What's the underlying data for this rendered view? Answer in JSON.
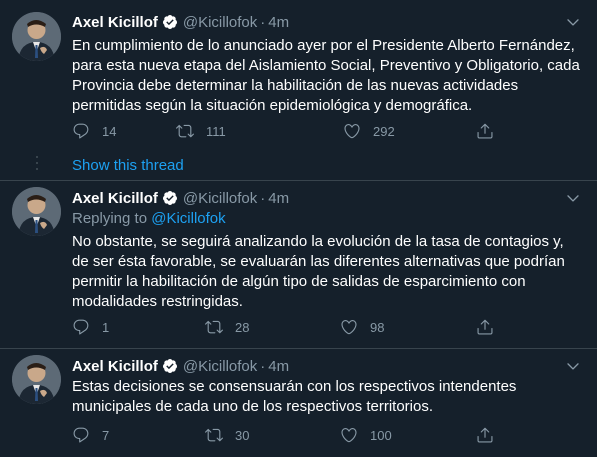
{
  "tweets": [
    {
      "name": "Axel Kicillof",
      "handle": "@Kicillofok",
      "time": "4m",
      "reply_prefix": "",
      "reply_handle": "",
      "text": "En cumplimiento de lo anunciado ayer por el Presidente Alberto Fernández, para esta nueva etapa del Aislamiento Social, Preventivo y Obligatorio, cada Provincia debe determinar la habilitación de las nuevas actividades permitidas según la situación epidemiológica y demográfica.",
      "replies": "14",
      "retweets": "111",
      "likes": "292"
    },
    {
      "name": "Axel Kicillof",
      "handle": "@Kicillofok",
      "time": "4m",
      "reply_prefix": "Replying to ",
      "reply_handle": "@Kicillofok",
      "text": "No obstante, se seguirá analizando la evolución de la tasa de contagios y, de ser ésta favorable, se evaluarán las diferentes alternativas que podrían permitir la habilitación de algún tipo de salidas de esparcimiento con modalidades restringidas.",
      "replies": "1",
      "retweets": "28",
      "likes": "98"
    },
    {
      "name": "Axel Kicillof",
      "handle": "@Kicillofok",
      "time": "4m",
      "reply_prefix": "",
      "reply_handle": "",
      "text": "Estas decisiones se consensuarán con los respectivos intendentes municipales de cada uno de los respectivos territorios.",
      "replies": "7",
      "retweets": "30",
      "likes": "100"
    }
  ],
  "show_thread": "Show this thread",
  "separator": "·",
  "colors": {
    "background": "#15202b",
    "accent": "#1da1f2",
    "muted": "#8899a6",
    "divider": "#38444d"
  },
  "icons": [
    "verified-badge-icon",
    "chevron-down-icon",
    "reply-icon",
    "retweet-icon",
    "like-icon",
    "share-icon"
  ]
}
